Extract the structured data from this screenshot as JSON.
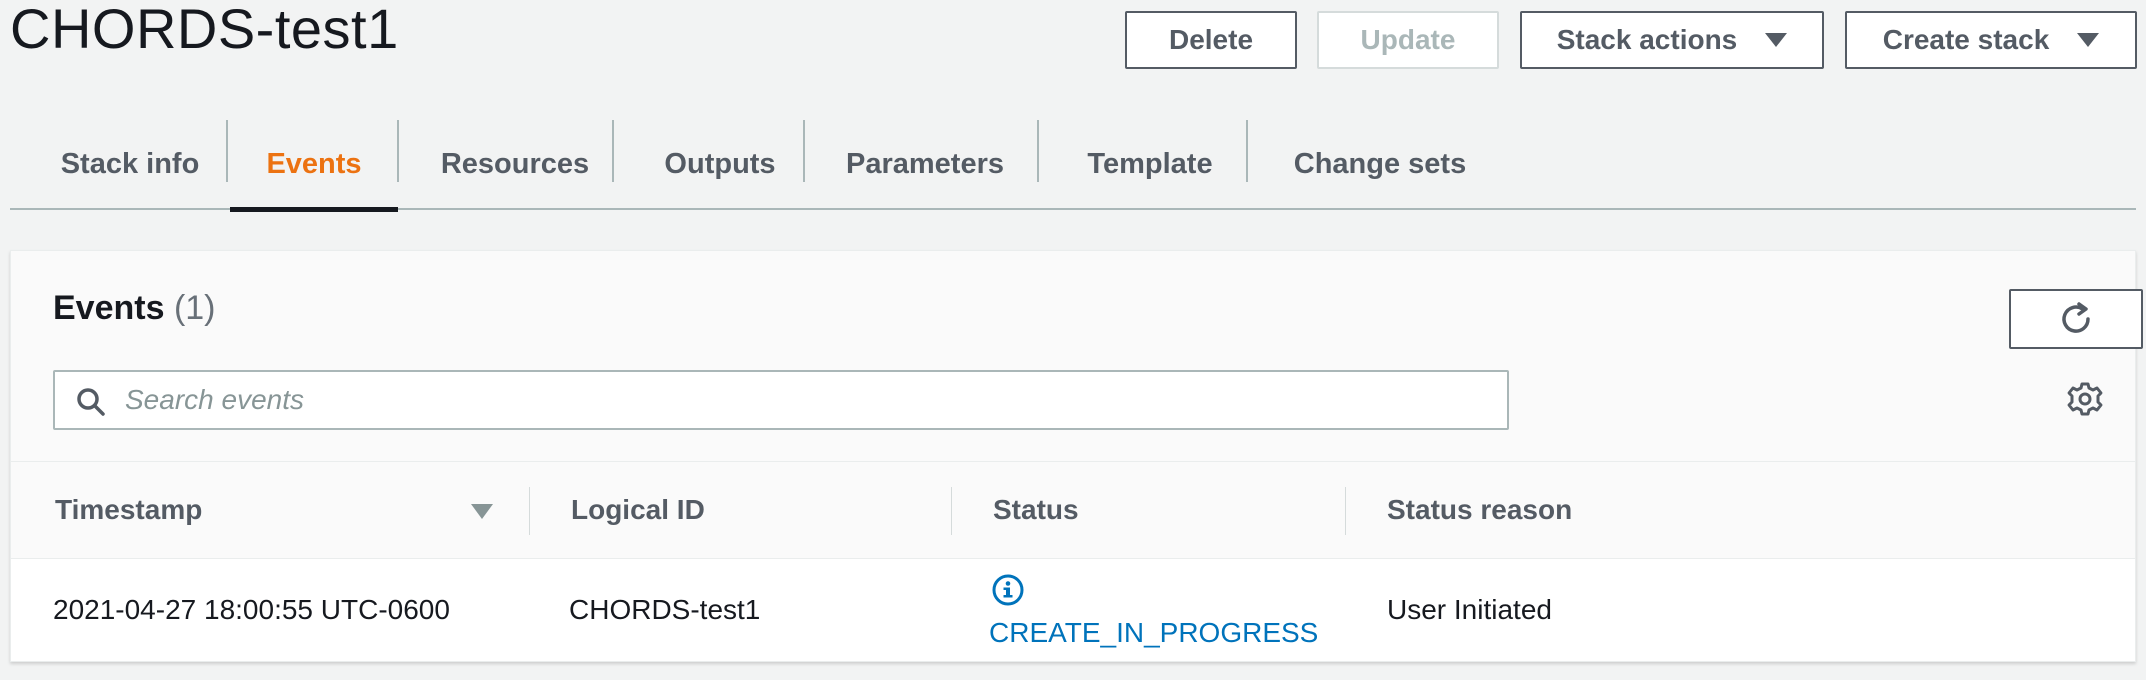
{
  "header": {
    "title": "CHORDS-test1"
  },
  "actions": {
    "delete": "Delete",
    "update": "Update",
    "stack_actions": "Stack actions",
    "create_stack": "Create stack"
  },
  "tabs": [
    {
      "label": "Stack info"
    },
    {
      "label": "Events",
      "active": true
    },
    {
      "label": "Resources"
    },
    {
      "label": "Outputs"
    },
    {
      "label": "Parameters"
    },
    {
      "label": "Template"
    },
    {
      "label": "Change sets"
    }
  ],
  "events_panel": {
    "title": "Events",
    "count": "(1)",
    "search_placeholder": "Search events",
    "search_value": "",
    "columns": [
      "Timestamp",
      "Logical ID",
      "Status",
      "Status reason"
    ],
    "rows": [
      {
        "timestamp": "2021-04-27 18:00:55 UTC-0600",
        "logical_id": "CHORDS-test1",
        "status": "CREATE_IN_PROGRESS",
        "status_icon": "info-circle-icon",
        "status_reason": "User Initiated"
      }
    ]
  },
  "colors": {
    "accent_active_tab": "#ec7211",
    "status_in_progress": "#0073bb",
    "button_border": "#545b64"
  }
}
